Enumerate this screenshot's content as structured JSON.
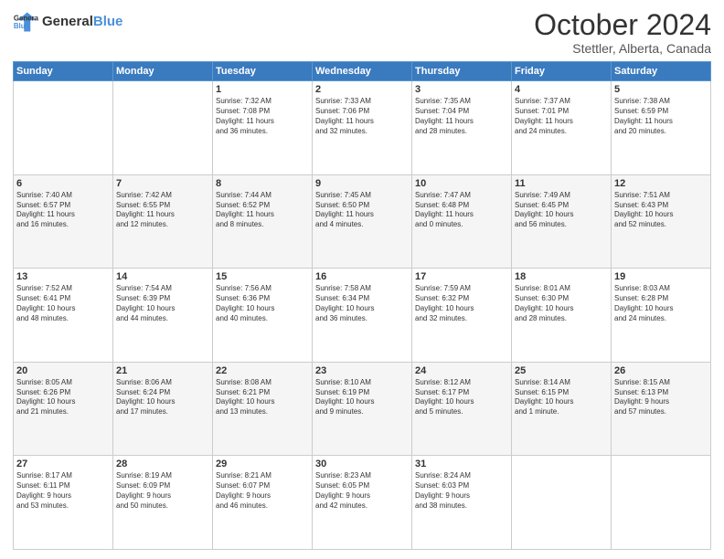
{
  "header": {
    "logo_line1": "General",
    "logo_line2": "Blue",
    "month": "October 2024",
    "location": "Stettler, Alberta, Canada"
  },
  "days_of_week": [
    "Sunday",
    "Monday",
    "Tuesday",
    "Wednesday",
    "Thursday",
    "Friday",
    "Saturday"
  ],
  "weeks": [
    [
      {
        "day": "",
        "detail": ""
      },
      {
        "day": "",
        "detail": ""
      },
      {
        "day": "1",
        "detail": "Sunrise: 7:32 AM\nSunset: 7:08 PM\nDaylight: 11 hours\nand 36 minutes."
      },
      {
        "day": "2",
        "detail": "Sunrise: 7:33 AM\nSunset: 7:06 PM\nDaylight: 11 hours\nand 32 minutes."
      },
      {
        "day": "3",
        "detail": "Sunrise: 7:35 AM\nSunset: 7:04 PM\nDaylight: 11 hours\nand 28 minutes."
      },
      {
        "day": "4",
        "detail": "Sunrise: 7:37 AM\nSunset: 7:01 PM\nDaylight: 11 hours\nand 24 minutes."
      },
      {
        "day": "5",
        "detail": "Sunrise: 7:38 AM\nSunset: 6:59 PM\nDaylight: 11 hours\nand 20 minutes."
      }
    ],
    [
      {
        "day": "6",
        "detail": "Sunrise: 7:40 AM\nSunset: 6:57 PM\nDaylight: 11 hours\nand 16 minutes."
      },
      {
        "day": "7",
        "detail": "Sunrise: 7:42 AM\nSunset: 6:55 PM\nDaylight: 11 hours\nand 12 minutes."
      },
      {
        "day": "8",
        "detail": "Sunrise: 7:44 AM\nSunset: 6:52 PM\nDaylight: 11 hours\nand 8 minutes."
      },
      {
        "day": "9",
        "detail": "Sunrise: 7:45 AM\nSunset: 6:50 PM\nDaylight: 11 hours\nand 4 minutes."
      },
      {
        "day": "10",
        "detail": "Sunrise: 7:47 AM\nSunset: 6:48 PM\nDaylight: 11 hours\nand 0 minutes."
      },
      {
        "day": "11",
        "detail": "Sunrise: 7:49 AM\nSunset: 6:45 PM\nDaylight: 10 hours\nand 56 minutes."
      },
      {
        "day": "12",
        "detail": "Sunrise: 7:51 AM\nSunset: 6:43 PM\nDaylight: 10 hours\nand 52 minutes."
      }
    ],
    [
      {
        "day": "13",
        "detail": "Sunrise: 7:52 AM\nSunset: 6:41 PM\nDaylight: 10 hours\nand 48 minutes."
      },
      {
        "day": "14",
        "detail": "Sunrise: 7:54 AM\nSunset: 6:39 PM\nDaylight: 10 hours\nand 44 minutes."
      },
      {
        "day": "15",
        "detail": "Sunrise: 7:56 AM\nSunset: 6:36 PM\nDaylight: 10 hours\nand 40 minutes."
      },
      {
        "day": "16",
        "detail": "Sunrise: 7:58 AM\nSunset: 6:34 PM\nDaylight: 10 hours\nand 36 minutes."
      },
      {
        "day": "17",
        "detail": "Sunrise: 7:59 AM\nSunset: 6:32 PM\nDaylight: 10 hours\nand 32 minutes."
      },
      {
        "day": "18",
        "detail": "Sunrise: 8:01 AM\nSunset: 6:30 PM\nDaylight: 10 hours\nand 28 minutes."
      },
      {
        "day": "19",
        "detail": "Sunrise: 8:03 AM\nSunset: 6:28 PM\nDaylight: 10 hours\nand 24 minutes."
      }
    ],
    [
      {
        "day": "20",
        "detail": "Sunrise: 8:05 AM\nSunset: 6:26 PM\nDaylight: 10 hours\nand 21 minutes."
      },
      {
        "day": "21",
        "detail": "Sunrise: 8:06 AM\nSunset: 6:24 PM\nDaylight: 10 hours\nand 17 minutes."
      },
      {
        "day": "22",
        "detail": "Sunrise: 8:08 AM\nSunset: 6:21 PM\nDaylight: 10 hours\nand 13 minutes."
      },
      {
        "day": "23",
        "detail": "Sunrise: 8:10 AM\nSunset: 6:19 PM\nDaylight: 10 hours\nand 9 minutes."
      },
      {
        "day": "24",
        "detail": "Sunrise: 8:12 AM\nSunset: 6:17 PM\nDaylight: 10 hours\nand 5 minutes."
      },
      {
        "day": "25",
        "detail": "Sunrise: 8:14 AM\nSunset: 6:15 PM\nDaylight: 10 hours\nand 1 minute."
      },
      {
        "day": "26",
        "detail": "Sunrise: 8:15 AM\nSunset: 6:13 PM\nDaylight: 9 hours\nand 57 minutes."
      }
    ],
    [
      {
        "day": "27",
        "detail": "Sunrise: 8:17 AM\nSunset: 6:11 PM\nDaylight: 9 hours\nand 53 minutes."
      },
      {
        "day": "28",
        "detail": "Sunrise: 8:19 AM\nSunset: 6:09 PM\nDaylight: 9 hours\nand 50 minutes."
      },
      {
        "day": "29",
        "detail": "Sunrise: 8:21 AM\nSunset: 6:07 PM\nDaylight: 9 hours\nand 46 minutes."
      },
      {
        "day": "30",
        "detail": "Sunrise: 8:23 AM\nSunset: 6:05 PM\nDaylight: 9 hours\nand 42 minutes."
      },
      {
        "day": "31",
        "detail": "Sunrise: 8:24 AM\nSunset: 6:03 PM\nDaylight: 9 hours\nand 38 minutes."
      },
      {
        "day": "",
        "detail": ""
      },
      {
        "day": "",
        "detail": ""
      }
    ]
  ]
}
